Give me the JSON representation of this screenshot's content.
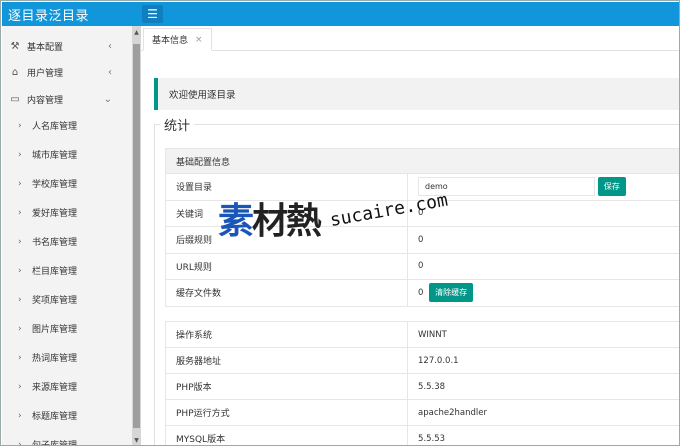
{
  "header": {
    "brand": "逐目录泛目录",
    "menu_icon": "menu-icon"
  },
  "sidebar": {
    "groups": [
      {
        "label": "基本配置",
        "icon": "settings-icon",
        "arrow": "‹"
      },
      {
        "label": "用户管理",
        "icon": "home-icon",
        "arrow": "‹"
      },
      {
        "label": "内容管理",
        "icon": "document-icon",
        "arrow": "⌄"
      }
    ],
    "sub_items": [
      "人名库管理",
      "城市库管理",
      "学校库管理",
      "爱好库管理",
      "书名库管理",
      "栏目库管理",
      "奖项库管理",
      "图片库管理",
      "热词库管理",
      "来源库管理",
      "标题库管理",
      "句子库管理"
    ]
  },
  "tabs": [
    {
      "label": "基本信息",
      "close": "×"
    }
  ],
  "main": {
    "welcome": "欢迎使用逐目录",
    "legend": "统计",
    "config": {
      "header": "基础配置信息",
      "rows": [
        {
          "key": "设置目录",
          "input": "demo",
          "button": "保存"
        },
        {
          "key": "关键词",
          "value": "0"
        },
        {
          "key": "后缀规则",
          "value": "0"
        },
        {
          "key": "URL规则",
          "value": "0"
        },
        {
          "key": "缓存文件数",
          "value": "0",
          "button": "清除缓存"
        }
      ]
    },
    "system": [
      {
        "key": "操作系统",
        "value": "WINNT"
      },
      {
        "key": "服务器地址",
        "value": "127.0.0.1"
      },
      {
        "key": "PHP版本",
        "value": "5.5.38"
      },
      {
        "key": "PHP运行方式",
        "value": "apache2handler"
      },
      {
        "key": "MYSQL版本",
        "value": "5.5.53"
      }
    ]
  },
  "watermark": {
    "cn_1": "素",
    "cn_2": "材熱",
    "en": "sucaire.com"
  }
}
